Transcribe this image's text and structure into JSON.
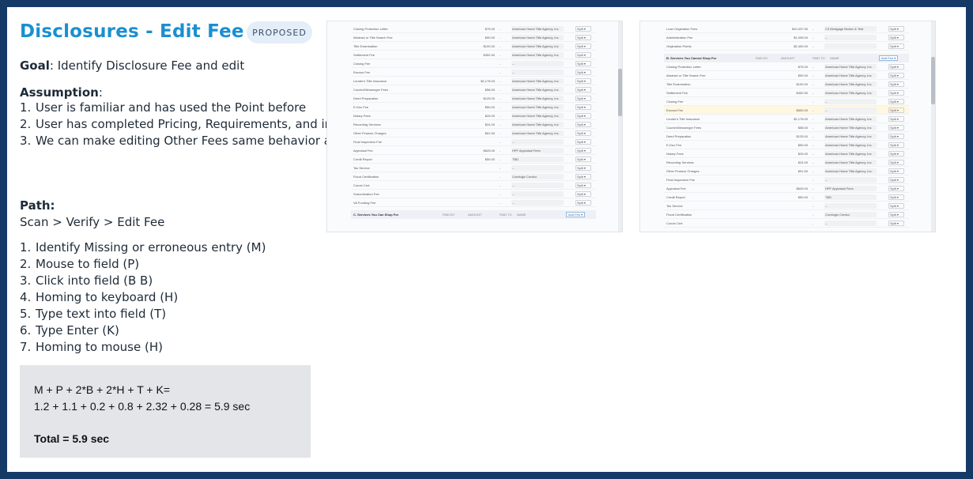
{
  "title": "Disclosures - Edit Fee",
  "badge": "PROPOSED",
  "goal": {
    "label": "Goal",
    "text": ": Identify Disclosure Fee and edit"
  },
  "assumption": {
    "label": "Assumption",
    "suffix": ":",
    "items": [
      "User is familiar and has used the Point before",
      "User has completed Pricing, Requirements, and imported SmartFees",
      "We can make editing Other Fees same behavior as curreng behavior for editing Fees inline"
    ]
  },
  "path": {
    "label": "Path:",
    "text": "Scan > Verify > Edit Fee",
    "steps": [
      "Identify Missing or erroneous entry (M)",
      "Mouse to field (P)",
      "Click into field (B B)",
      "Homing to keyboard (H)",
      "Type text into field (T)",
      "Type Enter (K)",
      "Homing to mouse (H)"
    ]
  },
  "calc": {
    "formula": "M + P + 2*B + 2*H + T + K=",
    "values": "1.2 + 1.1 + 0.2 + 0.8 + 2.32 + 0.28 = 5.9 sec",
    "total": "Total = 5.9 sec"
  },
  "screenshot_left": {
    "rows": [
      [
        "Closing Protection Letter",
        "$75.00",
        "American Home Title Agency, Inc"
      ],
      [
        "Abstract or Title Search Fee",
        "$90.00",
        "American Home Title Agency, Inc"
      ],
      [
        "Title Examination",
        "$100.00",
        "American Home Title Agency, Inc"
      ],
      [
        "Settlement Fee",
        "$352.50",
        "American Home Title Agency, Inc"
      ],
      [
        "Closing Fee",
        "",
        "--"
      ],
      [
        "Escrow Fee",
        "",
        "--"
      ],
      [
        "Lender's Title Insurance",
        "$2,178.00",
        "American Home Title Agency, Inc"
      ],
      [
        "Courier/Messenger Fees",
        "$58.00",
        "American Home Title Agency, Inc"
      ],
      [
        "Deed Preparation",
        "$125.00",
        "American Home Title Agency, Inc"
      ],
      [
        "E-Doc Fee",
        "$50.00",
        "American Home Title Agency, Inc"
      ],
      [
        "Notary Fees",
        "$25.00",
        "American Home Title Agency, Inc"
      ],
      [
        "Recording Services",
        "$24.00",
        "American Home Title Agency, Inc"
      ],
      [
        "Other Finance Charges",
        "$51.50",
        "American Home Title Agency, Inc"
      ],
      [
        "Final Inspection Fee",
        "",
        "--"
      ],
      [
        "Appraisal Fee",
        "$625.00",
        "HPF Appraisal Fees"
      ],
      [
        "Credit Report",
        "$50.00",
        "TBD"
      ],
      [
        "Tax Service",
        "",
        "--"
      ],
      [
        "Flood Certification",
        "",
        "Corelogic Credco"
      ],
      [
        "Condo Cert",
        "",
        "--"
      ],
      [
        "Subordination Fee",
        "",
        "--"
      ],
      [
        "VA Funding Fee",
        "",
        "--"
      ]
    ],
    "section": "C. Services You Can Shop For",
    "section_cols": [
      "PAID BY",
      "AMOUNT",
      "PAID TO",
      "NAME"
    ],
    "add_label": "Add Fee",
    "select_label": "Split"
  },
  "screenshot_right": {
    "top_rows": [
      [
        "Loan Origination Fees",
        "$10,037.50",
        "C3 Mortgage Broker & Test"
      ],
      [
        "Administration Fee",
        "$1,095.00",
        "--"
      ],
      [
        "Origination Points",
        "$2,400.00",
        ""
      ]
    ],
    "section": "B. Services You Cannot Shop For",
    "section_cols": [
      "PAID BY",
      "AMOUNT",
      "PAID TO",
      "NAME"
    ],
    "rows": [
      [
        "Closing Protection Letter",
        "$75.00",
        "American Home Title Agency, Inc"
      ],
      [
        "Abstract or Title Search Fee",
        "$90.00",
        "American Home Title Agency, Inc"
      ],
      [
        "Title Examination",
        "$100.00",
        "American Home Title Agency, Inc"
      ],
      [
        "Settlement Fee",
        "$352.50",
        "American Home Title Agency, Inc"
      ],
      [
        "Closing Fee",
        "",
        "--"
      ],
      [
        "Escrow Fee",
        "$500.00",
        "--"
      ],
      [
        "Lender's Title Insurance",
        "$2,178.00",
        "American Home Title Agency, Inc"
      ],
      [
        "Courier/Messenger Fees",
        "$58.00",
        "American Home Title Agency, Inc"
      ],
      [
        "Deed Preparation",
        "$125.00",
        "American Home Title Agency, Inc"
      ],
      [
        "E-Doc Fee",
        "$50.00",
        "American Home Title Agency, Inc"
      ],
      [
        "Notary Fees",
        "$25.00",
        "American Home Title Agency, Inc"
      ],
      [
        "Recording Services",
        "$24.00",
        "American Home Title Agency, Inc"
      ],
      [
        "Other Finance Charges",
        "$91.50",
        "American Home Title Agency, Inc"
      ],
      [
        "Final Inspection Fee",
        "",
        "--"
      ],
      [
        "Appraisal Fee",
        "$625.00",
        "HPF Appraisal Fees"
      ],
      [
        "Credit Report",
        "$50.00",
        "TBD"
      ],
      [
        "Tax Service",
        "",
        "--"
      ],
      [
        "Flood Certification",
        "",
        "Corelogic Credco"
      ],
      [
        "Condo Cert",
        "",
        "--"
      ]
    ],
    "add_label": "Add Fee",
    "select_label": "Split"
  }
}
